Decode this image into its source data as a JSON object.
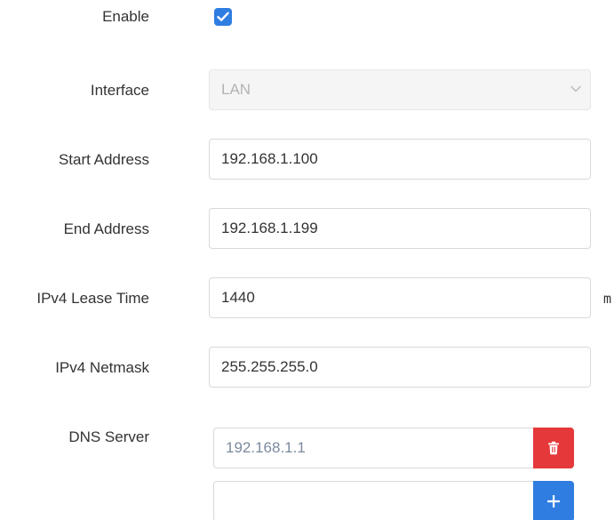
{
  "form": {
    "enable": {
      "label": "Enable",
      "checked": true
    },
    "interface": {
      "label": "Interface",
      "value": "LAN",
      "disabled": true
    },
    "start_address": {
      "label": "Start Address",
      "value": "192.168.1.100"
    },
    "end_address": {
      "label": "End Address",
      "value": "192.168.1.199"
    },
    "lease_time": {
      "label": "IPv4 Lease Time",
      "value": "1440",
      "unit": "m"
    },
    "netmask": {
      "label": "IPv4 Netmask",
      "value": "255.255.255.0"
    },
    "dns_server": {
      "label": "DNS Server",
      "entries": [
        "192.168.1.1",
        ""
      ]
    }
  },
  "colors": {
    "checkbox": "#2f7de1",
    "delete_button": "#e5383b",
    "add_button": "#2f7de1"
  },
  "icons": {
    "checkbox": "check-icon",
    "interface_select": "chevron-down-icon",
    "delete": "trash-icon",
    "add": "plus-icon"
  }
}
